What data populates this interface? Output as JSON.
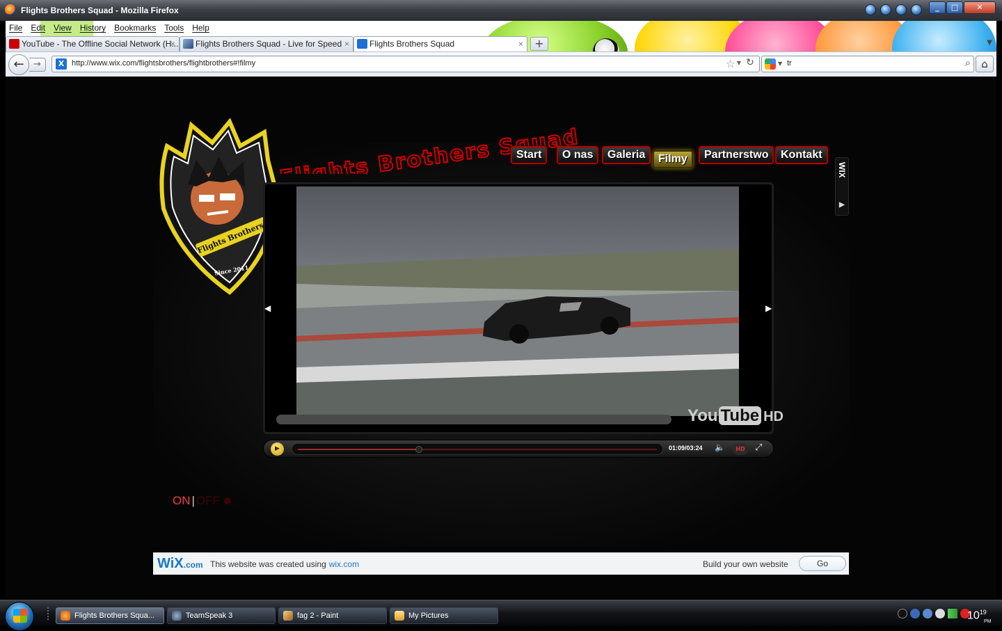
{
  "window": {
    "title": "Flights Brothers Squad - Mozilla Firefox"
  },
  "menu": [
    "File",
    "Edit",
    "View",
    "History",
    "Bookmarks",
    "Tools",
    "Help"
  ],
  "tabs": [
    {
      "label": "YouTube - The Offline Social Network (H...",
      "close": "×"
    },
    {
      "label": "Flights Brothers Squad - Live for Speed",
      "close": "×"
    },
    {
      "label": "Flights Brothers Squad",
      "close": "×"
    }
  ],
  "newtab_label": "+",
  "address": {
    "url": "http://www.wix.com/flightsbrothers/flightbrothers#!filmy"
  },
  "search": {
    "query": "tr"
  },
  "site": {
    "title_text": "Flights Brothers Squad",
    "logo_text": "Flights Brothers Squad",
    "logo_since": "Since 2011",
    "nav": [
      "Start",
      "O nas",
      "Galeria",
      "Filmy",
      "Partnerstwo",
      "Kontakt"
    ],
    "active_nav": "Filmy",
    "wix_side_label": "WIX"
  },
  "player": {
    "time_current": "01:09",
    "time_separator": "/",
    "time_total": "03:24",
    "progress": 0.338,
    "yt_you": "You",
    "yt_tube": "Tube",
    "yt_hd": "HD",
    "hd_label": "HD"
  },
  "toggle": {
    "on": "ON",
    "sep": "|",
    "off": "OFF"
  },
  "wixbar": {
    "logo": "WiX",
    "logo_tld": ".com",
    "text": "This website was created using",
    "link": "wix.com",
    "build": "Build your own website",
    "go": "Go"
  },
  "taskbar": [
    {
      "label": "Flights Brothers Squa..."
    },
    {
      "label": "TeamSpeak 3"
    },
    {
      "label": "fag 2 - Paint"
    },
    {
      "label": "My Pictures"
    }
  ],
  "clock": {
    "hour": "10",
    "minute": "19",
    "ampm": "PM"
  },
  "colors": {
    "nav_border": "#b00000",
    "nav_active": "#b8a63a",
    "wix_blue": "#1b78c8",
    "title_red": "#d00000"
  }
}
